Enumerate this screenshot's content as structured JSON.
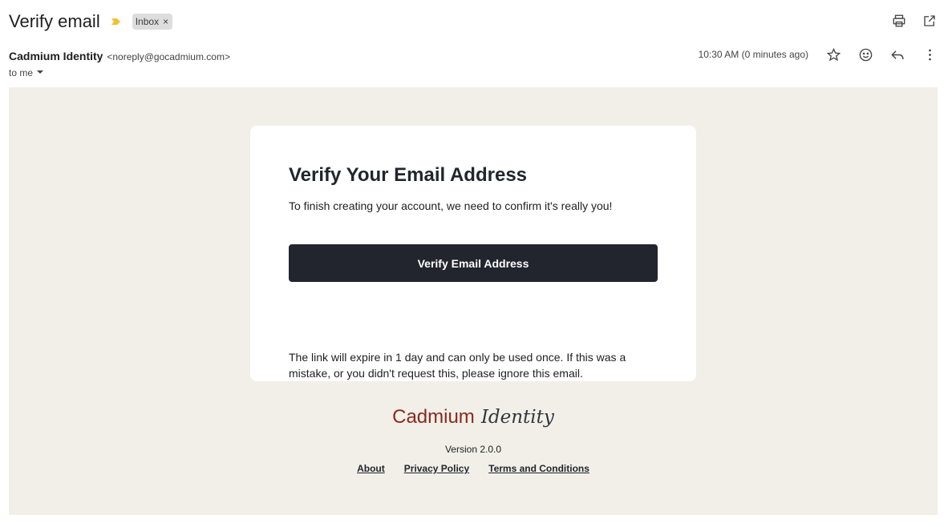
{
  "header": {
    "subject": "Verify email",
    "importance_icon": "importance-marker-icon",
    "label": "Inbox",
    "label_remove": "×",
    "actions": [
      "print-icon",
      "open-in-new-window-icon"
    ]
  },
  "sender": {
    "name": "Cadmium Identity",
    "email": "<noreply@gocadmium.com>",
    "to": "to me",
    "time": "10:30 AM (0 minutes ago)",
    "actions": [
      "star-icon",
      "emoji-icon",
      "reply-icon",
      "more-vert-icon"
    ]
  },
  "card": {
    "title": "Verify Your Email Address",
    "intro": "To finish creating your account, we need to confirm it's really you!",
    "button": "Verify Email Address",
    "note": "The link will expire in 1 day and can only be used once. If this was a mistake, or you didn't request this, please ignore this email."
  },
  "footer": {
    "brand_primary": "Cadmium",
    "brand_secondary": "Identity",
    "version": "Version 2.0.0",
    "links": [
      "About",
      "Privacy Policy",
      "Terms and Conditions"
    ]
  },
  "colors": {
    "body_bg": "#f1efe8",
    "button_bg": "#23252e",
    "brand_red": "#8a2a1c",
    "importance": "#f2c12e"
  }
}
